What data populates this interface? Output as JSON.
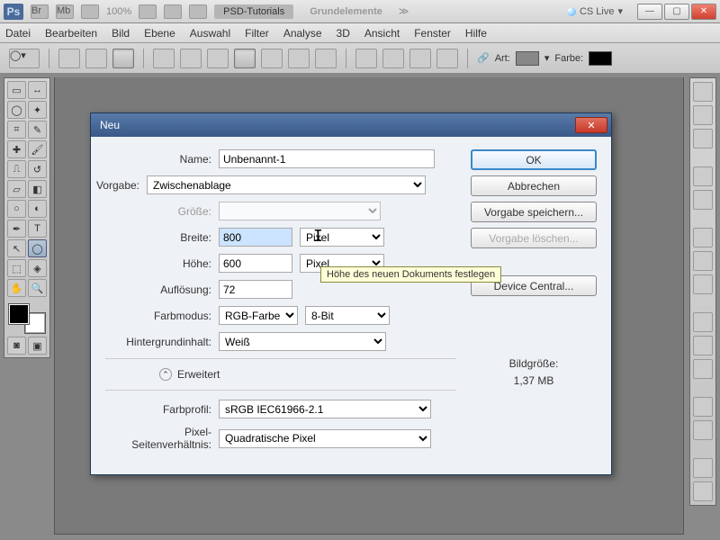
{
  "appbar": {
    "zoom": "100%",
    "tab_active": "PSD-Tutorials",
    "tab_inactive": "Grundelemente",
    "cslive": "CS Live"
  },
  "menu": [
    "Datei",
    "Bearbeiten",
    "Bild",
    "Ebene",
    "Auswahl",
    "Filter",
    "Analyse",
    "3D",
    "Ansicht",
    "Fenster",
    "Hilfe"
  ],
  "optbar": {
    "art": "Art:",
    "farbe": "Farbe:"
  },
  "dialog": {
    "title": "Neu",
    "labels": {
      "name": "Name:",
      "vorgabe": "Vorgabe:",
      "groesse": "Größe:",
      "breite": "Breite:",
      "hoehe": "Höhe:",
      "aufloesung": "Auflösung:",
      "farbmodus": "Farbmodus:",
      "hintergrund": "Hintergrundinhalt:",
      "erweitert": "Erweitert",
      "farbprofil": "Farbprofil:",
      "pixelsv": "Pixel-Seitenverhältnis:"
    },
    "values": {
      "name": "Unbenannt-1",
      "vorgabe": "Zwischenablage",
      "breite": "800",
      "hoehe": "600",
      "aufloesung": "72",
      "farbmodus": "RGB-Farbe",
      "bit": "8-Bit",
      "hintergrund": "Weiß",
      "farbprofil": "sRGB IEC61966-2.1",
      "pixelsv": "Quadratische Pixel",
      "unit_pixel": "Pixel"
    },
    "buttons": {
      "ok": "OK",
      "cancel": "Abbrechen",
      "save_preset": "Vorgabe speichern...",
      "delete_preset": "Vorgabe löschen...",
      "device_central": "Device Central..."
    },
    "info": {
      "label": "Bildgröße:",
      "value": "1,37 MB"
    },
    "tooltip": "Höhe des neuen Dokuments festlegen"
  }
}
